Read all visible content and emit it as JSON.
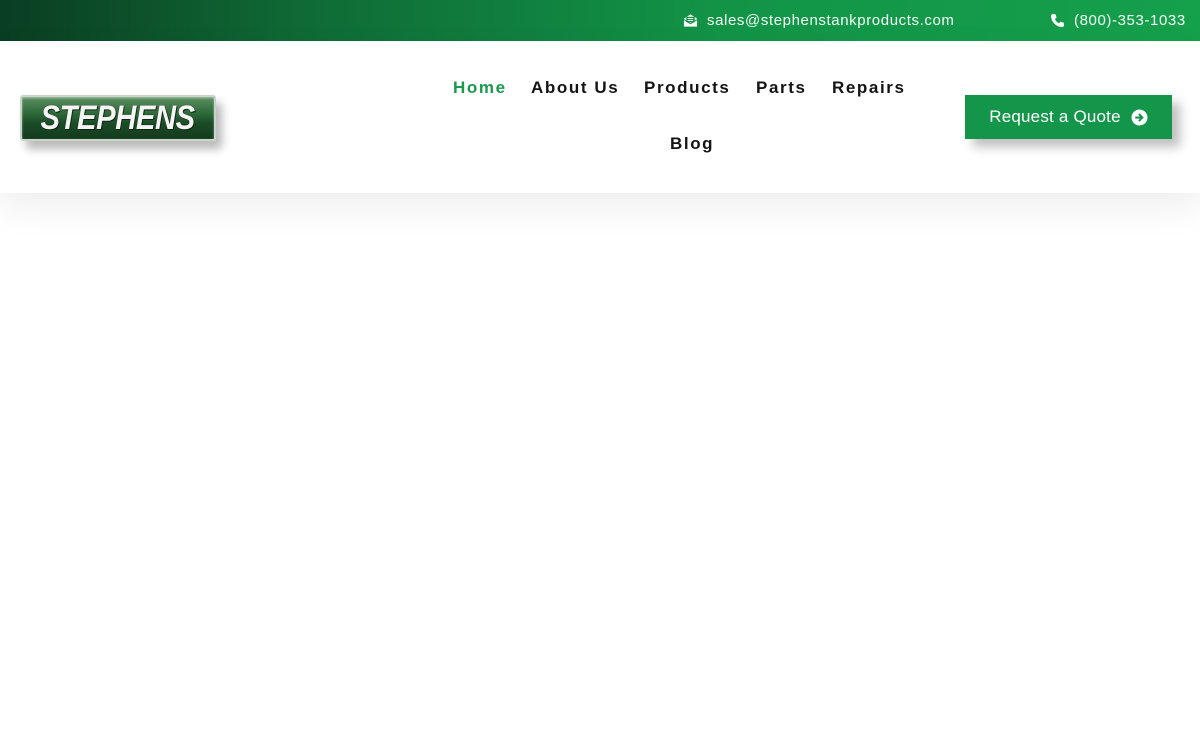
{
  "topbar": {
    "email": "sales@stephenstankproducts.com",
    "email_icon": "envelope-open-icon",
    "phone": "(800)-353-1033",
    "phone_icon": "phone-icon"
  },
  "header": {
    "logo_text": "STEPHENS",
    "nav": [
      {
        "label": "Home",
        "active": true
      },
      {
        "label": "About Us",
        "active": false
      },
      {
        "label": "Products",
        "active": false
      },
      {
        "label": "Parts",
        "active": false
      },
      {
        "label": "Repairs",
        "active": false
      },
      {
        "label": "Blog",
        "active": false
      }
    ],
    "cta": {
      "label": "Request a Quote",
      "icon": "arrow-circle-right-icon"
    }
  },
  "colors": {
    "brand_green": "#14964a",
    "active_link": "#1a9a4e",
    "topbar_gradient_start": "#0a3d22",
    "topbar_gradient_end": "#15a04c"
  }
}
